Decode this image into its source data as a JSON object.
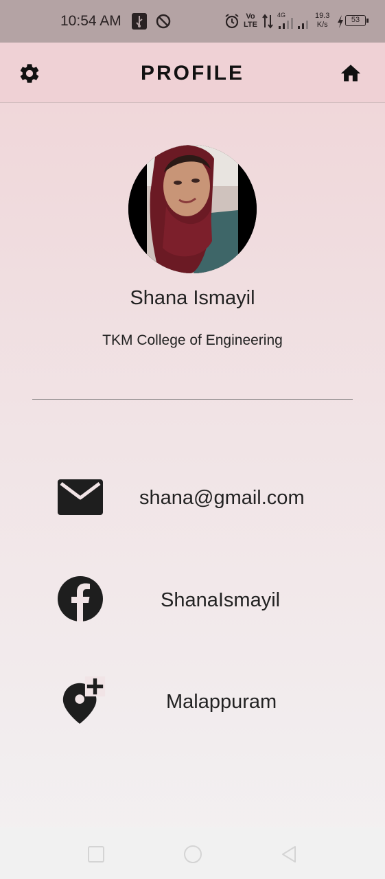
{
  "status_bar": {
    "time": "10:54 AM",
    "network_type": "4G",
    "speed_value": "19.3",
    "speed_unit": "K/s",
    "battery": "53",
    "volte": "Vo LTE"
  },
  "header": {
    "title": "PROFILE",
    "left_icon": "settings-gear-icon",
    "right_icon": "home-icon"
  },
  "profile": {
    "name": "Shana Ismayil",
    "college": "TKM College of Engineering"
  },
  "contacts": [
    {
      "icon": "mail-icon",
      "value": "shana@gmail.com"
    },
    {
      "icon": "facebook-icon",
      "value": "ShanaIsmayil"
    },
    {
      "icon": "add-location-icon",
      "value": "Malappuram"
    }
  ],
  "colors": {
    "background_top": "#efd3d6",
    "background_bottom": "#f3f1f2",
    "status_bar": "#b4a3a4",
    "icon": "#1e1e1e"
  }
}
